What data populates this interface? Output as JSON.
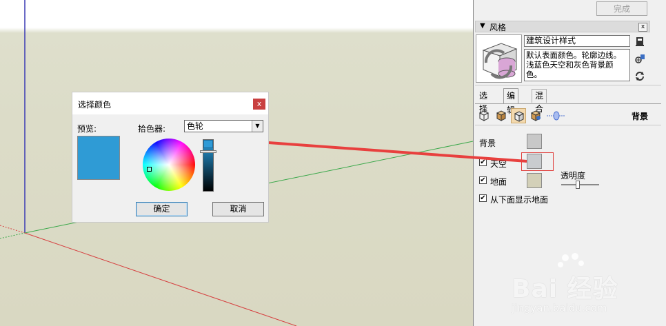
{
  "panel": {
    "done_button": "完成",
    "section_title": "风格",
    "close_glyph": "x",
    "style_name": "建筑设计样式",
    "style_description": "默认表面颜色。轮廓边线。浅蓝色天空和灰色背景颜色。",
    "tabs": [
      {
        "label": "选择"
      },
      {
        "label": "编辑"
      },
      {
        "label": "混合"
      }
    ],
    "active_tab": "编辑",
    "tool_section_label": "背景",
    "rows": {
      "background": {
        "label": "背景",
        "color": "#c8c8c8"
      },
      "sky": {
        "label": "天空",
        "checked": true,
        "color": "#c9cccf"
      },
      "ground": {
        "label": "地面",
        "checked": true,
        "color": "#d3d0b8"
      },
      "show_ground_below": {
        "label": "从下面显示地面",
        "checked": true
      }
    },
    "transparency_label": "透明度",
    "transparency_value": 0.43
  },
  "dialog": {
    "title": "选择颜色",
    "close_glyph": "x",
    "preview_label": "预览:",
    "preview_color": "#2f9bd5",
    "picker_label": "拾色器:",
    "picker_mode": "色轮",
    "ok_label": "确定",
    "cancel_label": "取消"
  },
  "watermark": {
    "text": "Bai 经验",
    "url": "jingyan.baidu.com"
  },
  "colors": {
    "arrow": "#e8403e",
    "highlight": "#e0413e",
    "axis_red": "#d64040",
    "axis_green": "#3aa84a",
    "axis_blue": "#3a3ab4"
  }
}
